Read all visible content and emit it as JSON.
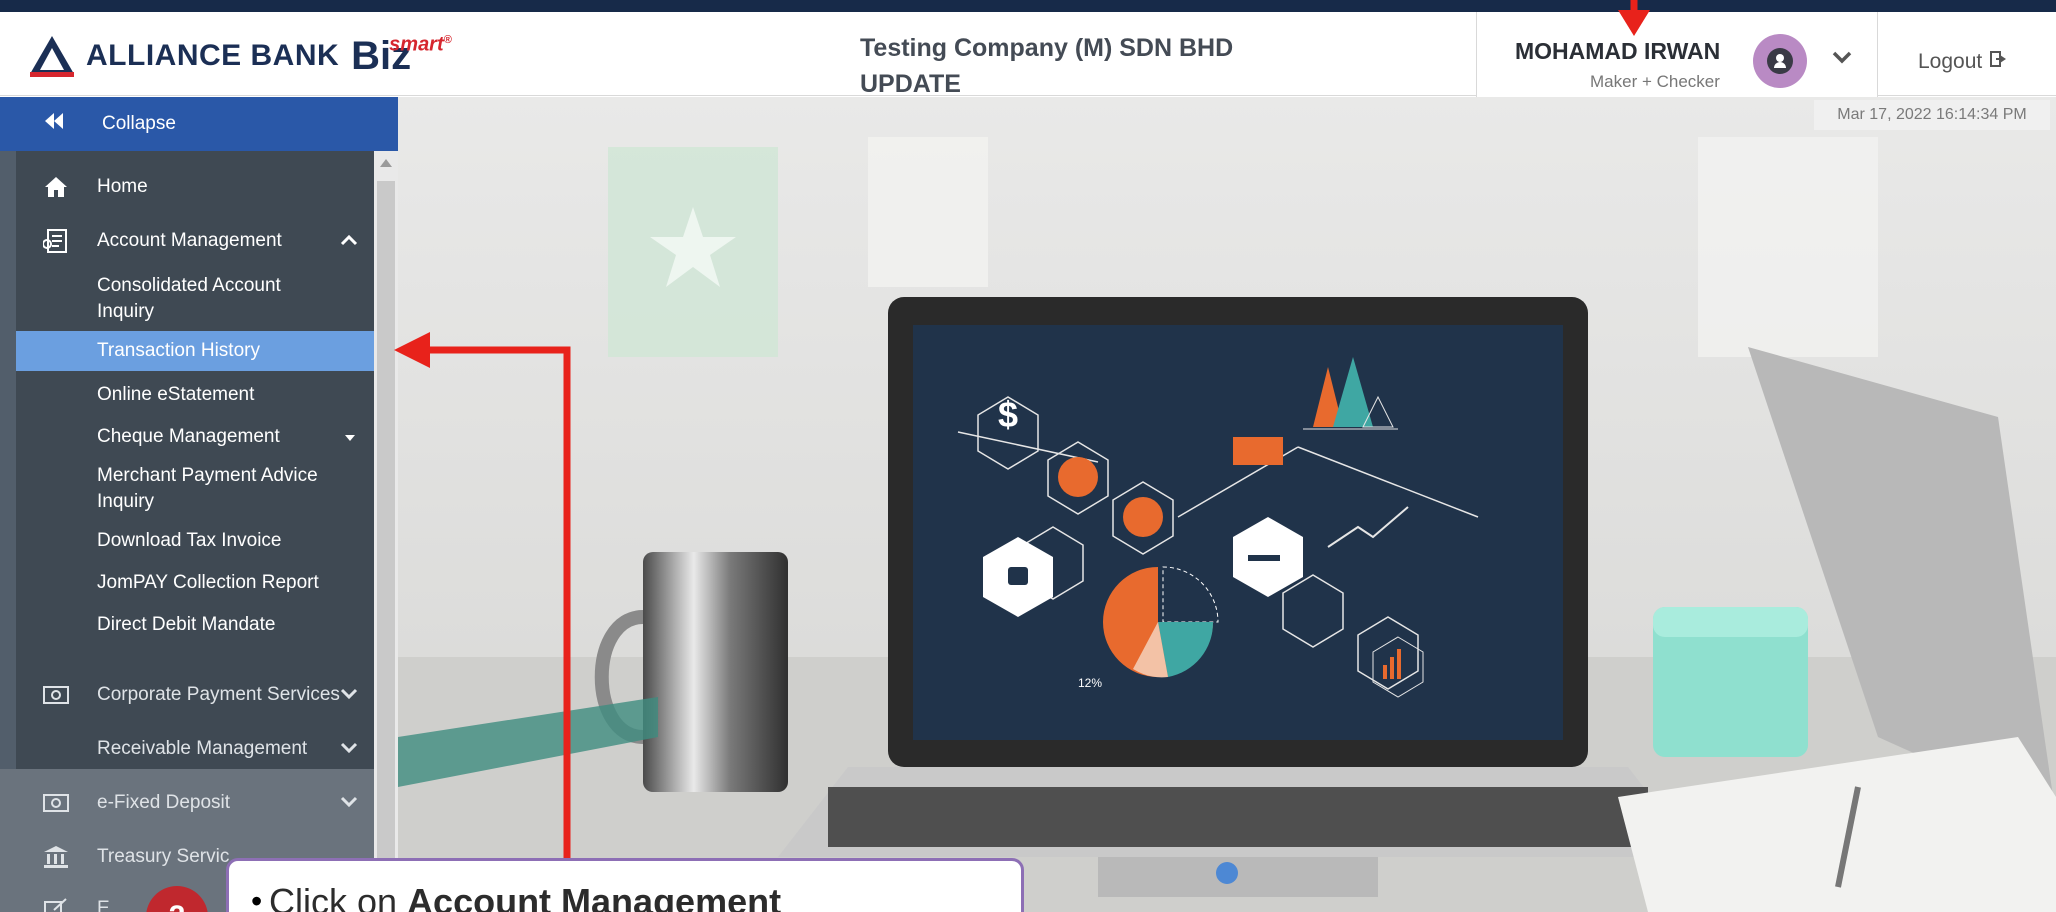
{
  "header": {
    "brand_text": "ALLIANCE BANK",
    "brand_biz": "Biz",
    "brand_smart": "smart",
    "brand_reg": "®",
    "company_line1": "Testing Company (M) SDN BHD",
    "company_line2": "UPDATE",
    "user_name": "MOHAMAD IRWAN",
    "user_role": "Maker + Checker",
    "logout_label": "Logout",
    "datetime": "Mar 17, 2022 16:14:34 PM"
  },
  "sidebar": {
    "collapse_label": "Collapse",
    "items": [
      {
        "label": "Home",
        "icon": "home-icon"
      },
      {
        "label": "Account Management",
        "icon": "ledger-icon"
      },
      {
        "label": "Consolidated Account Inquiry"
      },
      {
        "label": "Transaction History",
        "active": true
      },
      {
        "label": "Online eStatement"
      },
      {
        "label": "Cheque Management"
      },
      {
        "label": "Merchant Payment Advice Inquiry"
      },
      {
        "label": "Download Tax Invoice"
      },
      {
        "label": "JomPAY Collection Report"
      },
      {
        "label": "Direct Debit Mandate"
      },
      {
        "label": "Corporate Payment Services",
        "icon": "banknote-icon"
      },
      {
        "label": "Receivable Management"
      },
      {
        "label": "e-Fixed Deposit",
        "icon": "banknote-icon"
      },
      {
        "label": "Treasury Servic",
        "icon": "bank-building-icon"
      },
      {
        "label": "E",
        "icon": "edit-icon"
      }
    ]
  },
  "callout": {
    "bullet": "•",
    "prefix": "Click on ",
    "bold": "Account Management",
    "step_number": "2"
  },
  "colors": {
    "brand_navy": "#1b2f55",
    "brand_red": "#d6262e",
    "sidebar_bg": "#3f4953",
    "active_item": "#6b9fe0",
    "collapse_bar": "#2a58a8",
    "annotation_red": "#e8221b",
    "callout_border": "#8d6fb5"
  }
}
